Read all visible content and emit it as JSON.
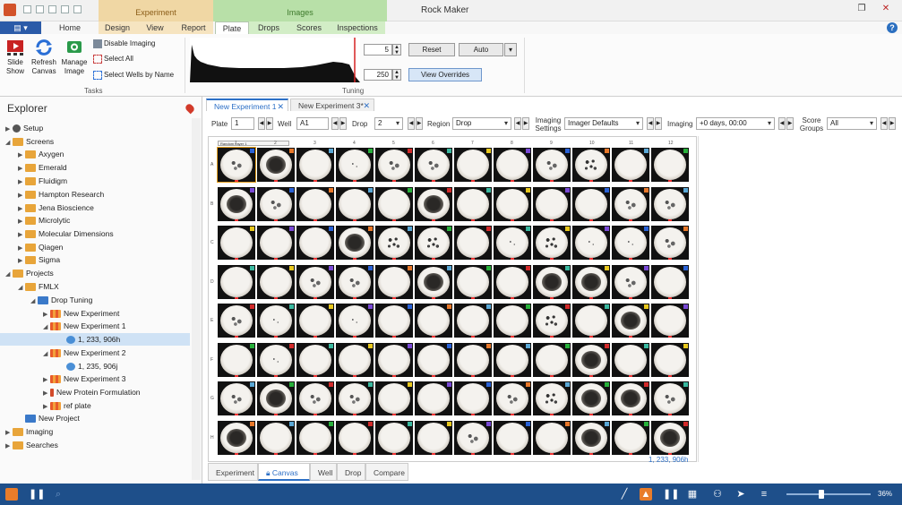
{
  "window": {
    "title": "Rock Maker"
  },
  "ribbon_groups": {
    "experiment": "Experiment",
    "images": "Images"
  },
  "tabs": {
    "file_glyph": "▤ ▾",
    "home": "Home",
    "design": "Design",
    "view": "View",
    "report": "Report",
    "plate": "Plate",
    "drops": "Drops",
    "scores": "Scores",
    "inspections": "Inspections"
  },
  "ribbon": {
    "slide_show": "Slide Show",
    "refresh_canvas": "Refresh Canvas",
    "manage_image": "Manage Image",
    "disable_imaging": "Disable Imaging",
    "select_all": "Select All",
    "select_wells_by_name": "Select Wells by Name",
    "tasks_label": "Tasks",
    "tuning_label": "Tuning",
    "tuning_low": "5",
    "tuning_high": "250",
    "reset": "Reset",
    "auto": "Auto",
    "view_overrides": "View Overrides"
  },
  "explorer": {
    "title": "Explorer",
    "items": [
      {
        "label": "Setup"
      },
      {
        "label": "Screens"
      },
      {
        "label": "Axygen"
      },
      {
        "label": "Emerald"
      },
      {
        "label": "Fluidigm"
      },
      {
        "label": "Hampton Research"
      },
      {
        "label": "Jena Bioscience"
      },
      {
        "label": "Microlytic"
      },
      {
        "label": "Molecular Dimensions"
      },
      {
        "label": "Qiagen"
      },
      {
        "label": "Sigma"
      },
      {
        "label": "Projects"
      },
      {
        "label": "FMLX"
      },
      {
        "label": "Drop Tuning"
      },
      {
        "label": "New Experiment"
      },
      {
        "label": "New Experiment 1"
      },
      {
        "label": "1, 233, 906h"
      },
      {
        "label": "New Experiment 2"
      },
      {
        "label": "1, 235, 906j"
      },
      {
        "label": "New Experiment 3"
      },
      {
        "label": "New Protein Formulation"
      },
      {
        "label": "ref plate"
      },
      {
        "label": "New Project"
      },
      {
        "label": "Imaging"
      },
      {
        "label": "Searches"
      }
    ]
  },
  "doc_tabs": [
    {
      "label": "New Experiment 1"
    },
    {
      "label": "New Experiment 3*"
    }
  ],
  "filters": {
    "plate_label": "Plate",
    "plate_value": "1",
    "well_label": "Well",
    "well_value": "A1",
    "drop_label": "Drop",
    "drop_value": "2",
    "region_label": "Region",
    "region_value": "Drop",
    "imaging_settings_label": "Imaging Settings",
    "imaging_settings_value": "Imager Defaults",
    "imaging_label": "Imaging",
    "imaging_value": "+0 days, 00:00",
    "score_groups_label": "Score Groups",
    "score_groups_value": "All"
  },
  "canvas": {
    "random_label": "Random Layer 1",
    "columns": [
      "1",
      "2",
      "3",
      "4",
      "5",
      "6",
      "7",
      "8",
      "9",
      "10",
      "11",
      "12"
    ],
    "rows": [
      "A",
      "B",
      "C",
      "D",
      "E",
      "F",
      "G",
      "H"
    ],
    "plate_caption": "1, 233, 906h",
    "badge_colors": [
      "#2a62d6",
      "#27b03a",
      "#e8c81e",
      "#e8782a",
      "#d22a2a",
      "#7a4ad6",
      "#5aa8d6",
      "#3ab9a0"
    ],
    "wells": [
      [
        "crystals",
        "dark",
        "clear",
        "dots",
        "crystals",
        "crystals",
        "clear",
        "clear",
        "crystals",
        "clusters",
        "clear",
        "clear"
      ],
      [
        "dark",
        "crystals",
        "clear",
        "clear",
        "clear",
        "dark",
        "clear",
        "clear",
        "clear",
        "clear",
        "crystals",
        "crystals"
      ],
      [
        "clear",
        "clear",
        "clear",
        "dark",
        "clusters",
        "clusters",
        "clear",
        "dots",
        "clusters",
        "dots",
        "dots",
        "crystals"
      ],
      [
        "clear",
        "clear",
        "crystals",
        "crystals",
        "clear",
        "dark",
        "clear",
        "clear",
        "dark",
        "dark",
        "crystals",
        "clear"
      ],
      [
        "crystals",
        "dots",
        "clear",
        "dots",
        "clear",
        "clear",
        "clear",
        "clear",
        "clusters",
        "clear",
        "dark",
        "clear"
      ],
      [
        "clear",
        "dots",
        "clear",
        "clear",
        "clear",
        "clear",
        "clear",
        "clear",
        "clear",
        "dark",
        "clear",
        "clear"
      ],
      [
        "crystals",
        "dark",
        "crystals",
        "crystals",
        "clear",
        "clear",
        "clear",
        "crystals",
        "clusters",
        "dark",
        "dark",
        "crystals"
      ],
      [
        "dark",
        "clear",
        "clear",
        "clear",
        "clear",
        "clear",
        "crystals",
        "clear",
        "clear",
        "dark",
        "clear",
        "dark"
      ]
    ]
  },
  "view_tabs": [
    {
      "label": "Experiment"
    },
    {
      "label": "Canvas"
    },
    {
      "label": "Well"
    },
    {
      "label": "Drop"
    },
    {
      "label": "Compare"
    }
  ],
  "status": {
    "zoom": "36%"
  }
}
